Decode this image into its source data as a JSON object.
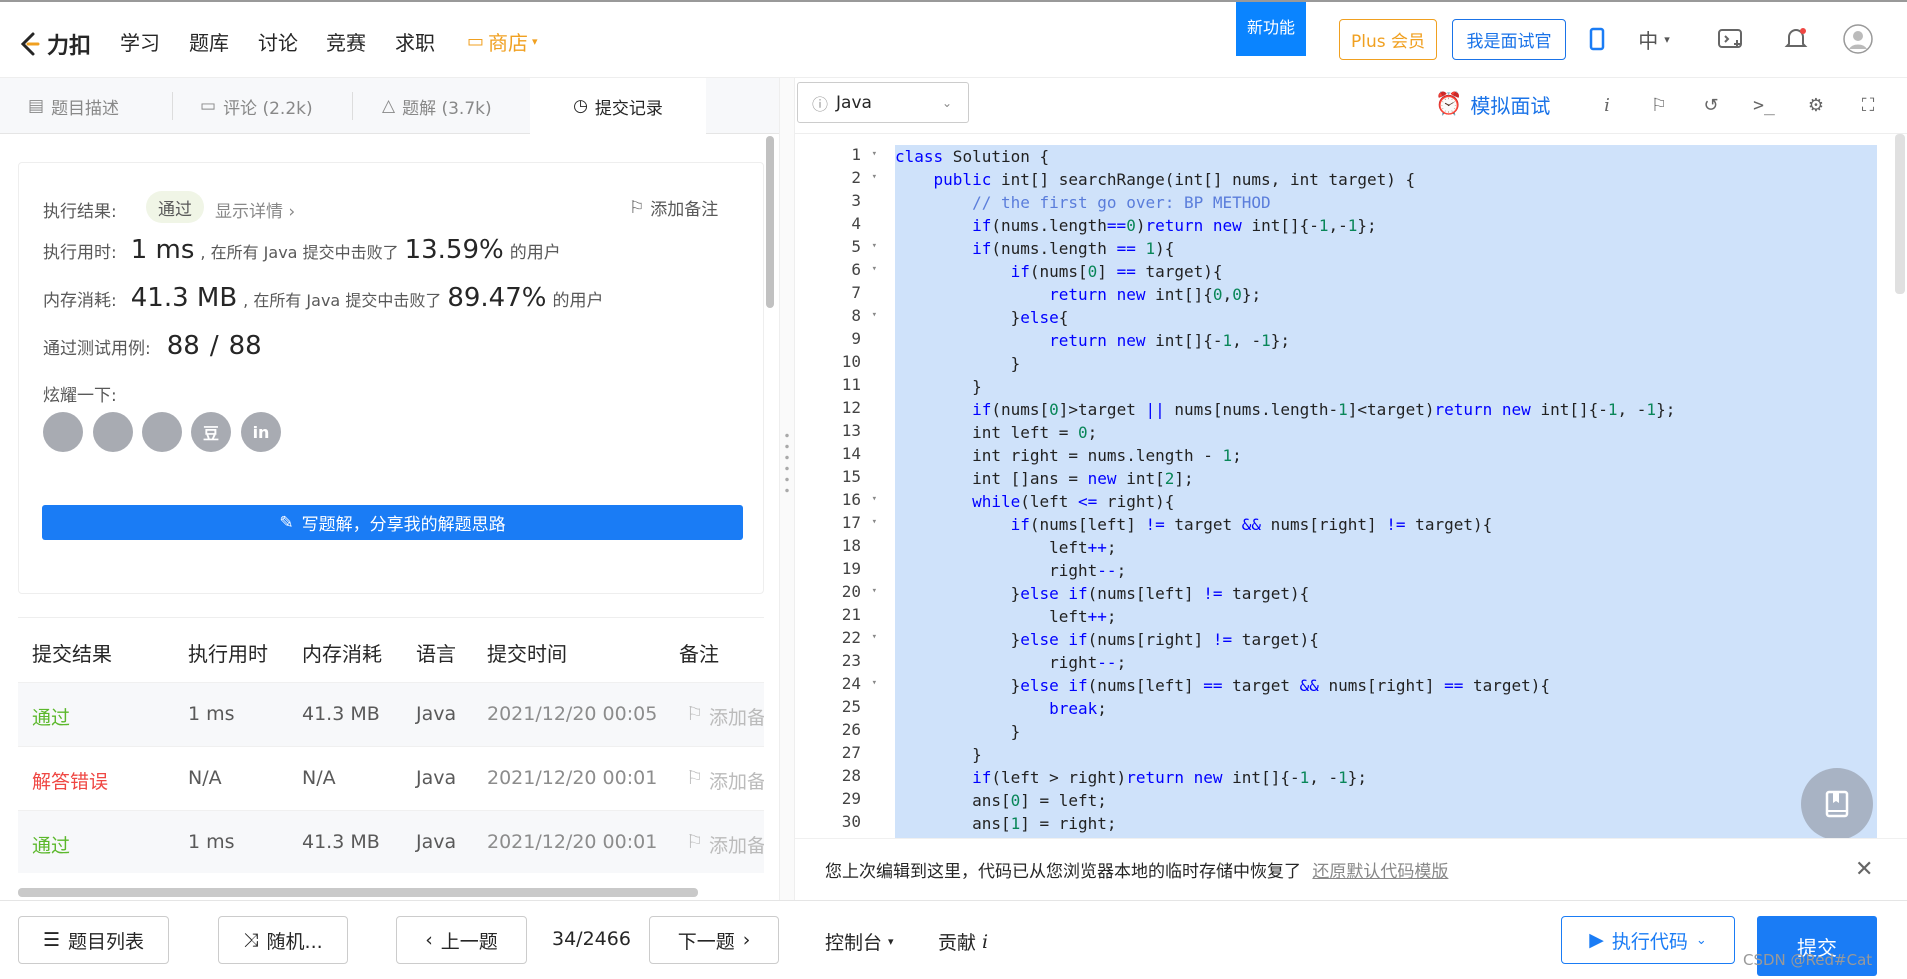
{
  "topnav": {
    "logo_text": "力扣",
    "links": [
      "学习",
      "题库",
      "讨论",
      "竞赛",
      "求职"
    ],
    "shop": "商店",
    "new_feature": "新功能",
    "plus": "Plus 会员",
    "interviewer": "我是面试官",
    "lang": "中"
  },
  "tabs": {
    "description": "题目描述",
    "comments": "评论 (2.2k)",
    "solutions": "题解 (3.7k)",
    "submissions": "提交记录"
  },
  "result": {
    "label": "执行结果:",
    "status": "通过",
    "details": "显示详情 ›",
    "add_note": "添加备注",
    "runtime_label": "执行用时:",
    "runtime_value": "1 ms",
    "runtime_text": ", 在所有 Java 提交中击败了",
    "runtime_pct": "13.59%",
    "users": "的用户",
    "memory_label": "内存消耗:",
    "memory_value": "41.3 MB",
    "memory_text": ", 在所有 Java 提交中击败了",
    "memory_pct": "89.47%",
    "cases_label": "通过测试用例:",
    "cases_passed": "88",
    "cases_sep": "/",
    "cases_total": "88",
    "share_label": "炫耀一下:",
    "social": [
      "wechat-icon",
      "weibo-icon",
      "qq-icon",
      "douban-icon",
      "linkedin-icon"
    ],
    "social_glyphs": [
      "",
      "",
      "",
      "豆",
      "in"
    ],
    "write_solution": "写题解，分享我的解题思路"
  },
  "submissions": {
    "headers": [
      "提交结果",
      "执行用时",
      "内存消耗",
      "语言",
      "提交时间",
      "备注"
    ],
    "rows": [
      {
        "result": "通过",
        "time": "1 ms",
        "memory": "41.3 MB",
        "lang": "Java",
        "date": "2021/12/20 00:05",
        "note": "添加备"
      },
      {
        "result": "解答错误",
        "time": "N/A",
        "memory": "N/A",
        "lang": "Java",
        "date": "2021/12/20 00:01",
        "note": "添加备"
      },
      {
        "result": "通过",
        "time": "1 ms",
        "memory": "41.3 MB",
        "lang": "Java",
        "date": "2021/12/20 00:01",
        "note": "添加备"
      }
    ]
  },
  "editor": {
    "language": "Java",
    "mock_interview": "模拟面试",
    "line_numbers": [
      "1",
      "2",
      "3",
      "4",
      "5",
      "6",
      "7",
      "8",
      "9",
      "10",
      "11",
      "12",
      "13",
      "14",
      "15",
      "16",
      "17",
      "18",
      "19",
      "20",
      "21",
      "22",
      "23",
      "24",
      "25",
      "26",
      "27",
      "28",
      "29",
      "30"
    ],
    "code": [
      "class Solution {",
      "    public int[] searchRange(int[] nums, int target) {",
      "        // the first go over: BP METHOD",
      "        if(nums.length==0)return new int[]{-1,-1};",
      "        if(nums.length == 1){",
      "            if(nums[0] == target){",
      "                return new int[]{0,0};",
      "            }else{",
      "                return new int[]{-1, -1};",
      "            }",
      "        }",
      "        if(nums[0]>target || nums[nums.length-1]<target)return new int[]{-1, -1};",
      "        int left = 0;",
      "        int right = nums.length - 1;",
      "        int []ans = new int[2];",
      "        while(left <= right){",
      "            if(nums[left] != target && nums[right] != target){",
      "                left++;",
      "                right--;",
      "            }else if(nums[left] != target){",
      "                left++;",
      "            }else if(nums[right] != target){",
      "                right--;",
      "            }else if(nums[left] == target && nums[right] == target){",
      "                break;",
      "            }",
      "        }",
      "        if(left > right)return new int[]{-1, -1};",
      "        ans[0] = left;",
      "        ans[1] = right;"
    ]
  },
  "notice": {
    "text": "您上次编辑到这里，代码已从您浏览器本地的临时存储中恢复了",
    "restore_link": "还原默认代码模版"
  },
  "bottombar": {
    "problem_list": "题目列表",
    "random": "随机...",
    "prev": "上一题",
    "counter": "34/2466",
    "next": "下一题",
    "console": "控制台",
    "contribute": "贡献",
    "run": "执行代码",
    "submit": "提交",
    "watermark": "CSDN @Red#Cat"
  }
}
